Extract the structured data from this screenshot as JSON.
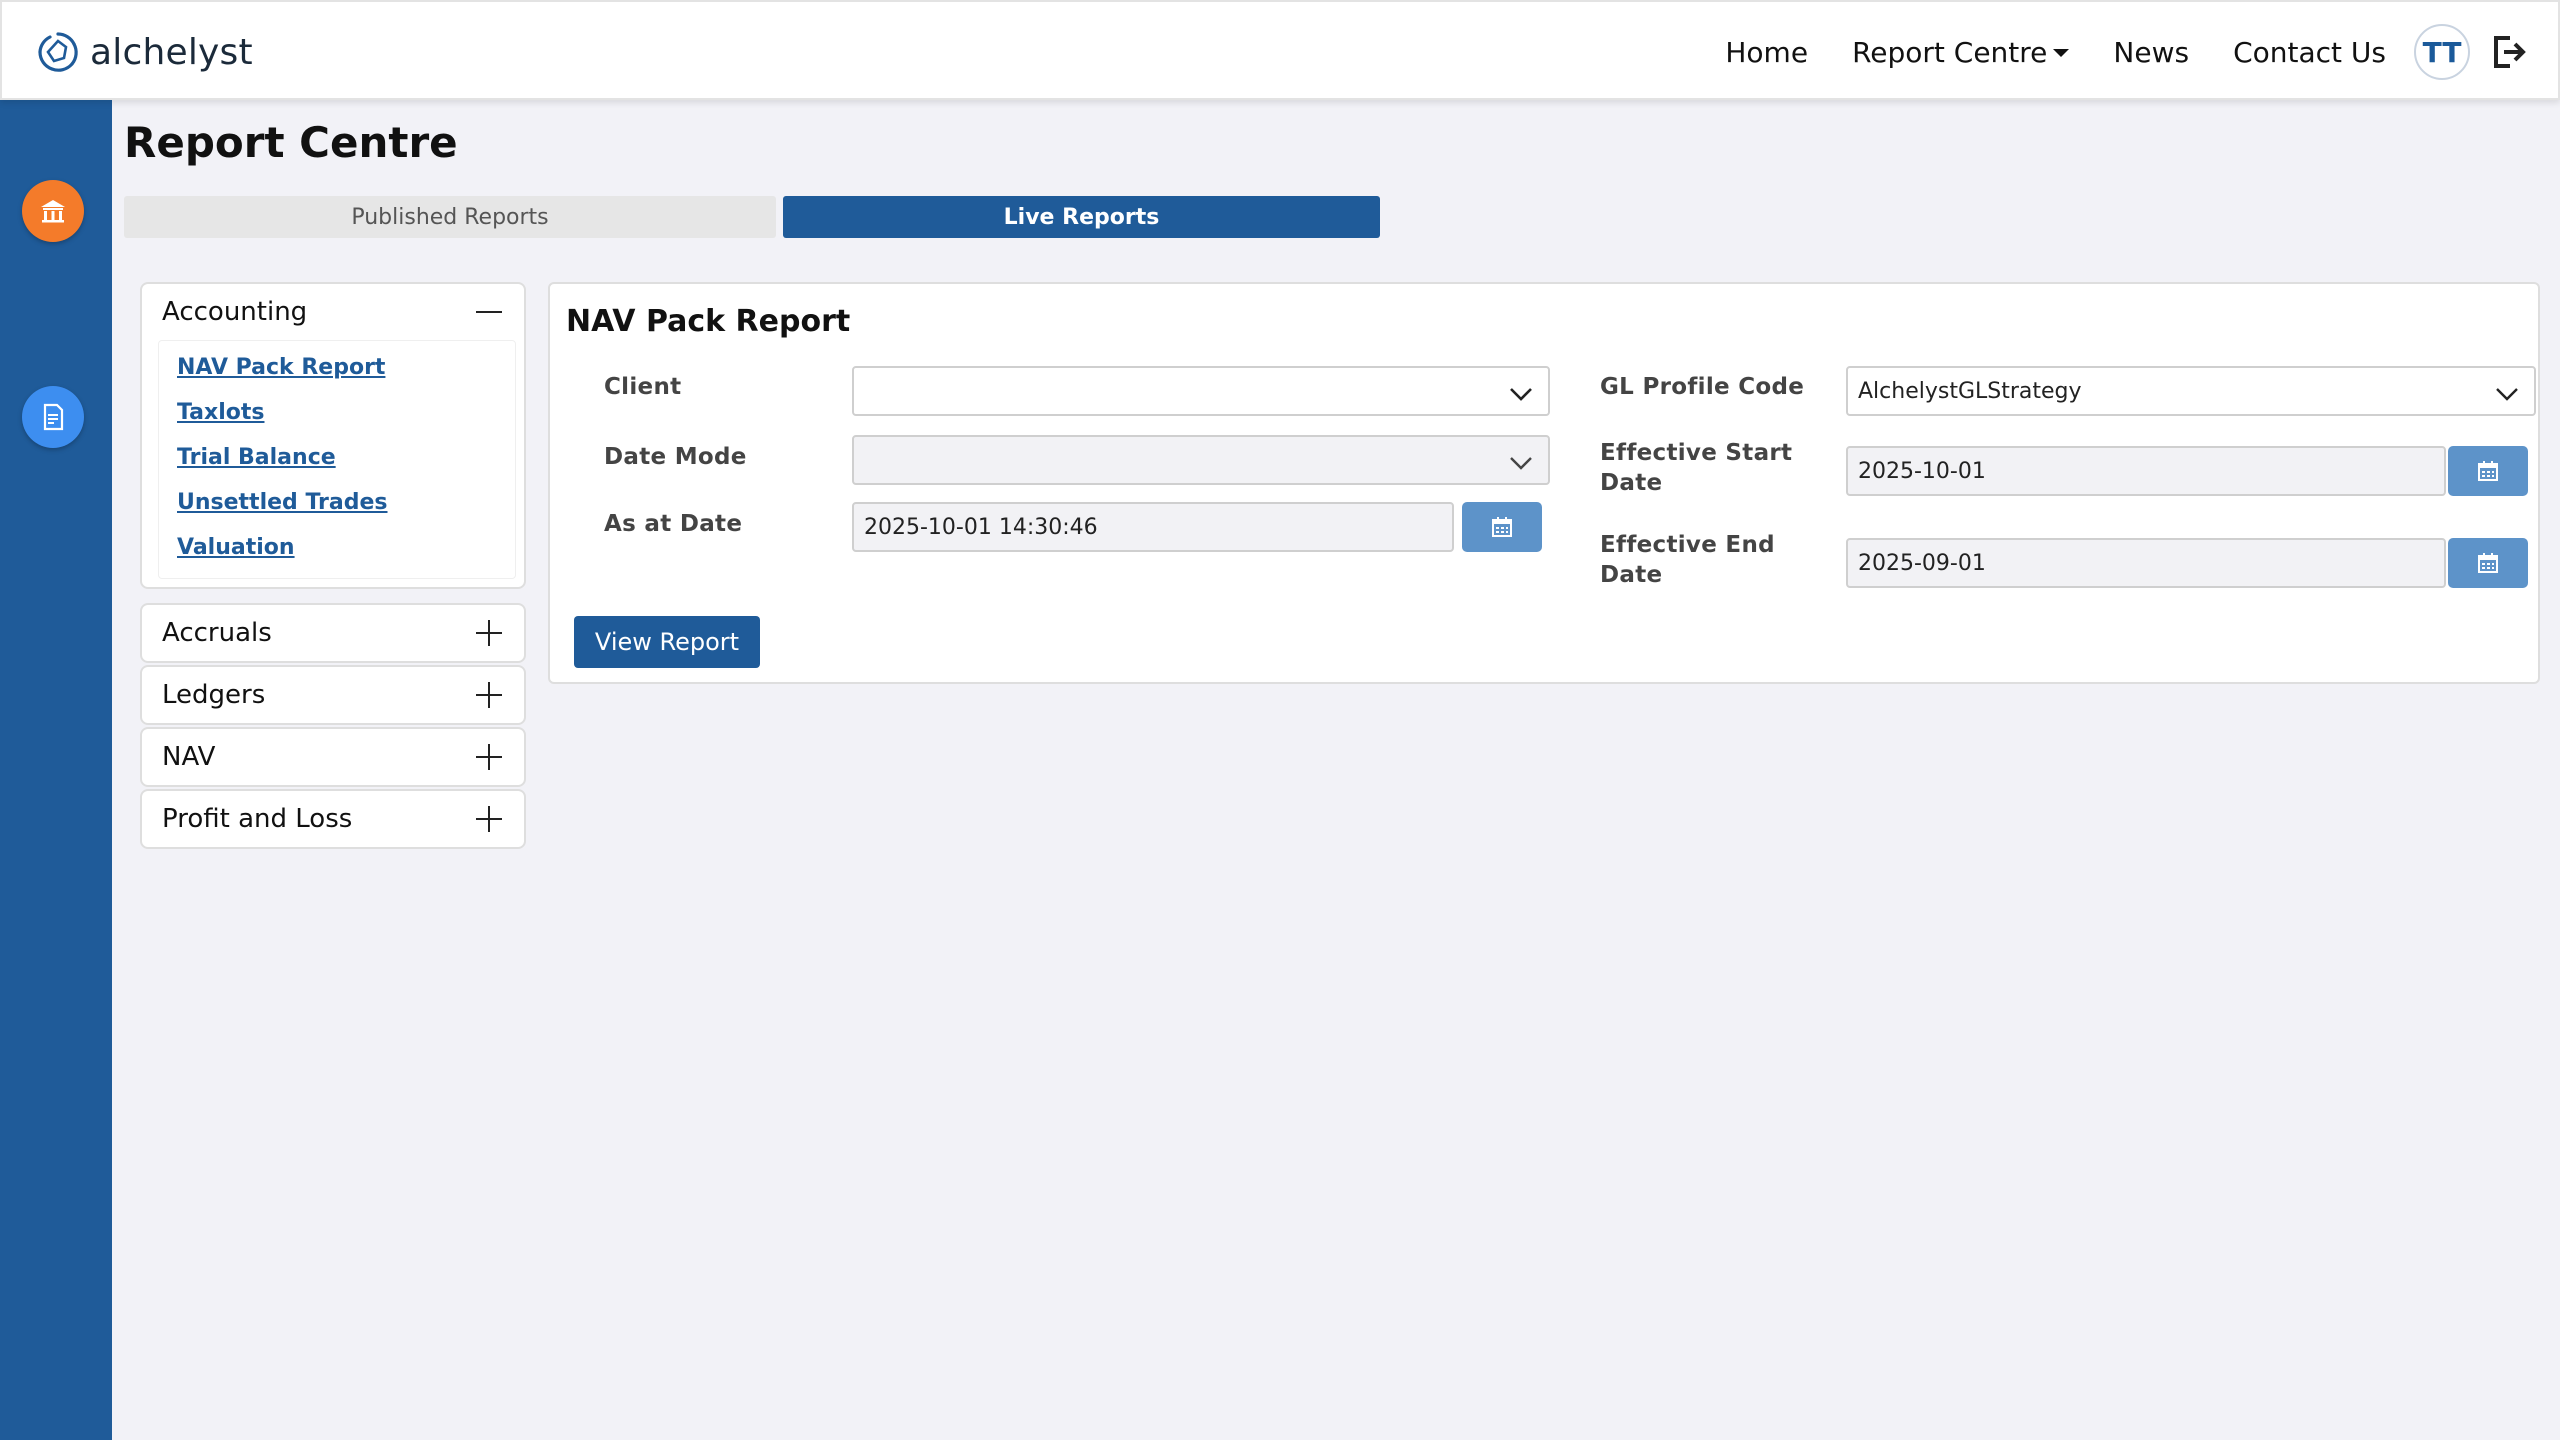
{
  "brand": {
    "name": "alchelyst"
  },
  "nav": {
    "home": "Home",
    "report_centre": "Report Centre",
    "news": "News",
    "contact": "Contact Us",
    "avatar_initials": "TT"
  },
  "sidebar": {
    "icons": [
      "bank-icon",
      "report-document-icon"
    ],
    "colors": {
      "background": "#1f5b99",
      "orange": "#f47b2a",
      "blue": "#3d8ef0"
    }
  },
  "page": {
    "title": "Report Centre",
    "tabs": [
      {
        "label": "Published Reports",
        "active": false
      },
      {
        "label": "Live Reports",
        "active": true
      }
    ]
  },
  "categories": [
    {
      "title": "Accounting",
      "expanded": true,
      "items": [
        "NAV Pack Report",
        "Taxlots",
        "Trial Balance",
        "Unsettled Trades",
        "Valuation"
      ]
    },
    {
      "title": "Accruals",
      "expanded": false
    },
    {
      "title": "Ledgers",
      "expanded": false
    },
    {
      "title": "NAV",
      "expanded": false
    },
    {
      "title": "Profit and Loss",
      "expanded": false
    }
  ],
  "form": {
    "title": "NAV Pack Report",
    "client_label": "Client",
    "client_value": "",
    "date_mode_label": "Date Mode",
    "date_mode_value": "",
    "as_at_label": "As at Date",
    "as_at_value": "2025-10-01 14:30:46",
    "gl_profile_label": "GL Profile Code",
    "gl_profile_value": "AlchelystGLStrategy",
    "eff_start_label_1": "Effective Start",
    "eff_start_label_2": "Date",
    "eff_start_value": "2025-10-01",
    "eff_end_label_1": "Effective End",
    "eff_end_label_2": "Date",
    "eff_end_value": "2025-09-01",
    "submit_label": "View Report"
  },
  "colors": {
    "primary": "#1f5b99",
    "calendar_button": "#5d93c9"
  }
}
